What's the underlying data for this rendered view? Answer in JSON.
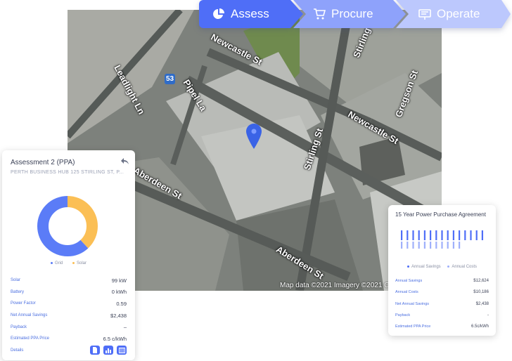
{
  "steps": [
    {
      "label": "Assess",
      "icon": "pie-chart-icon"
    },
    {
      "label": "Procure",
      "icon": "cart-icon"
    },
    {
      "label": "Operate",
      "icon": "presentation-icon"
    }
  ],
  "map": {
    "streets": {
      "newcastle_top": "Newcastle St",
      "stirling_top": "Stirling St",
      "leadlight": "Leadlight Ln",
      "pipel": "Pipel La",
      "newcastle_right": "Newcastle St",
      "gregson": "Gregson St",
      "stirling_mid": "Stirling St",
      "aberdeen_left": "Aberdeen St",
      "aberdeen_bottom": "Aberdeen St"
    },
    "route_number": "53",
    "attribution": "Map data ©2021 Imagery ©2021 CNES / Airbus, M"
  },
  "assessment": {
    "title": "Assessment 2 (PPA)",
    "address": "PERTH BUSINESS HUB 125 STIRLING ST, P...",
    "donut": {
      "grid_fraction": 0.62,
      "solar_fraction": 0.38,
      "grid_color": "#5b7cf7",
      "solar_color": "#fbbf55"
    },
    "legend": {
      "grid": "Grid",
      "solar": "Solar"
    },
    "rows": [
      {
        "label": "Solar",
        "value": "99 kW"
      },
      {
        "label": "Battery",
        "value": "0 kWh"
      },
      {
        "label": "Power Factor",
        "value": "0.59"
      },
      {
        "label": "Net Annual Savings",
        "value": "$2,438"
      },
      {
        "label": "Payback",
        "value": "–"
      },
      {
        "label": "Estimated PPA Price",
        "value": "6.5 c/kWh"
      }
    ],
    "details_label": "Details",
    "detail_icons": [
      "document-icon",
      "bar-chart-icon",
      "table-icon"
    ]
  },
  "ppa": {
    "title": "15 Year Power Purchase Agreement",
    "legend": {
      "savings": "Annual Savings",
      "costs": "Annual Costs"
    },
    "rows": [
      {
        "label": "Annual Savings",
        "value": "$12,624"
      },
      {
        "label": "Annual Costs",
        "value": "$10,186"
      },
      {
        "label": "Net Annual Savings",
        "value": "$2,438"
      },
      {
        "label": "Payback",
        "value": "-"
      },
      {
        "label": "Estimated PPA Price",
        "value": "6.5c/kWh"
      }
    ],
    "bar_color_savings": "#4f6ef7",
    "bar_color_costs": "#9fb0fb"
  }
}
